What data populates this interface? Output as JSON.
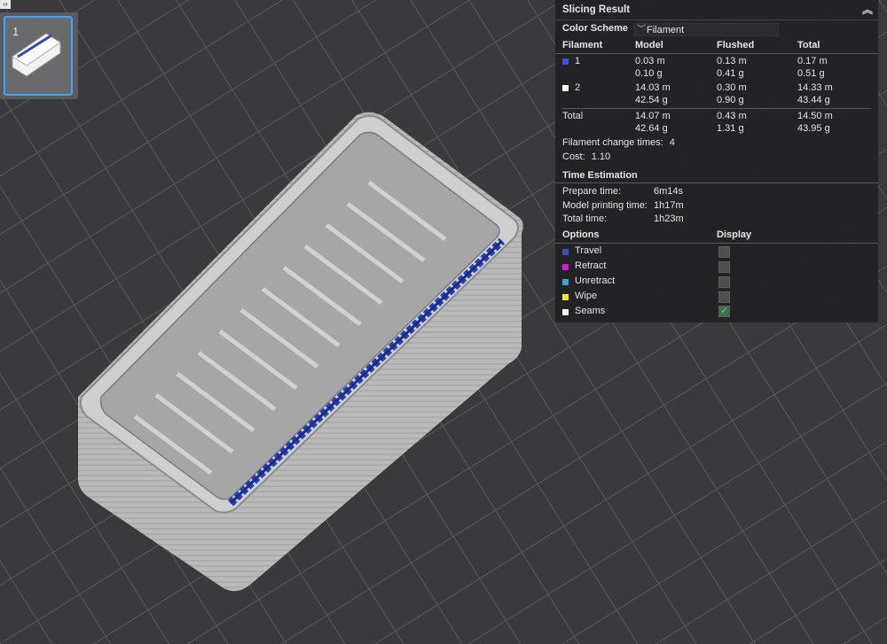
{
  "plate": {
    "number": "1"
  },
  "toggle": {
    "icon": "‹›"
  },
  "panel": {
    "title": "Slicing Result",
    "color_scheme_label": "Color Scheme",
    "color_scheme_value": "Filament",
    "headers": [
      "Filament",
      "Model",
      "Flushed",
      "Total"
    ],
    "filaments": [
      {
        "id": "1",
        "color": "#3a55d9",
        "model_m": "0.03 m",
        "model_g": "0.10 g",
        "flushed_m": "0.13 m",
        "flushed_g": "0.41 g",
        "total_m": "0.17 m",
        "total_g": "0.51 g"
      },
      {
        "id": "2",
        "color": "#ffffff",
        "model_m": "14.03 m",
        "model_g": "42.54 g",
        "flushed_m": "0.30 m",
        "flushed_g": "0.90 g",
        "total_m": "14.33 m",
        "total_g": "43.44 g"
      }
    ],
    "total": {
      "label": "Total",
      "model_m": "14.07 m",
      "model_g": "42.64 g",
      "flushed_m": "0.43 m",
      "flushed_g": "1.31 g",
      "total_m": "14.50 m",
      "total_g": "43.95 g"
    },
    "change_times_label": "Filament change times:",
    "change_times_value": "4",
    "cost_label": "Cost:",
    "cost_value": "1.10",
    "time_title": "Time Estimation",
    "prepare_label": "Prepare time:",
    "prepare_value": "6m14s",
    "model_print_label": "Model printing time:",
    "model_print_value": "1h17m",
    "total_time_label": "Total time:",
    "total_time_value": "1h23m",
    "options_header": "Options",
    "display_header": "Display",
    "options": [
      {
        "label": "Travel",
        "color": "#3b4dbf",
        "checked": false
      },
      {
        "label": "Retract",
        "color": "#d21bd2",
        "checked": false
      },
      {
        "label": "Unretract",
        "color": "#3aa3c8",
        "checked": false
      },
      {
        "label": "Wipe",
        "color": "#f0f000",
        "checked": false
      },
      {
        "label": "Seams",
        "color": "#f2f2f2",
        "checked": true
      }
    ]
  }
}
